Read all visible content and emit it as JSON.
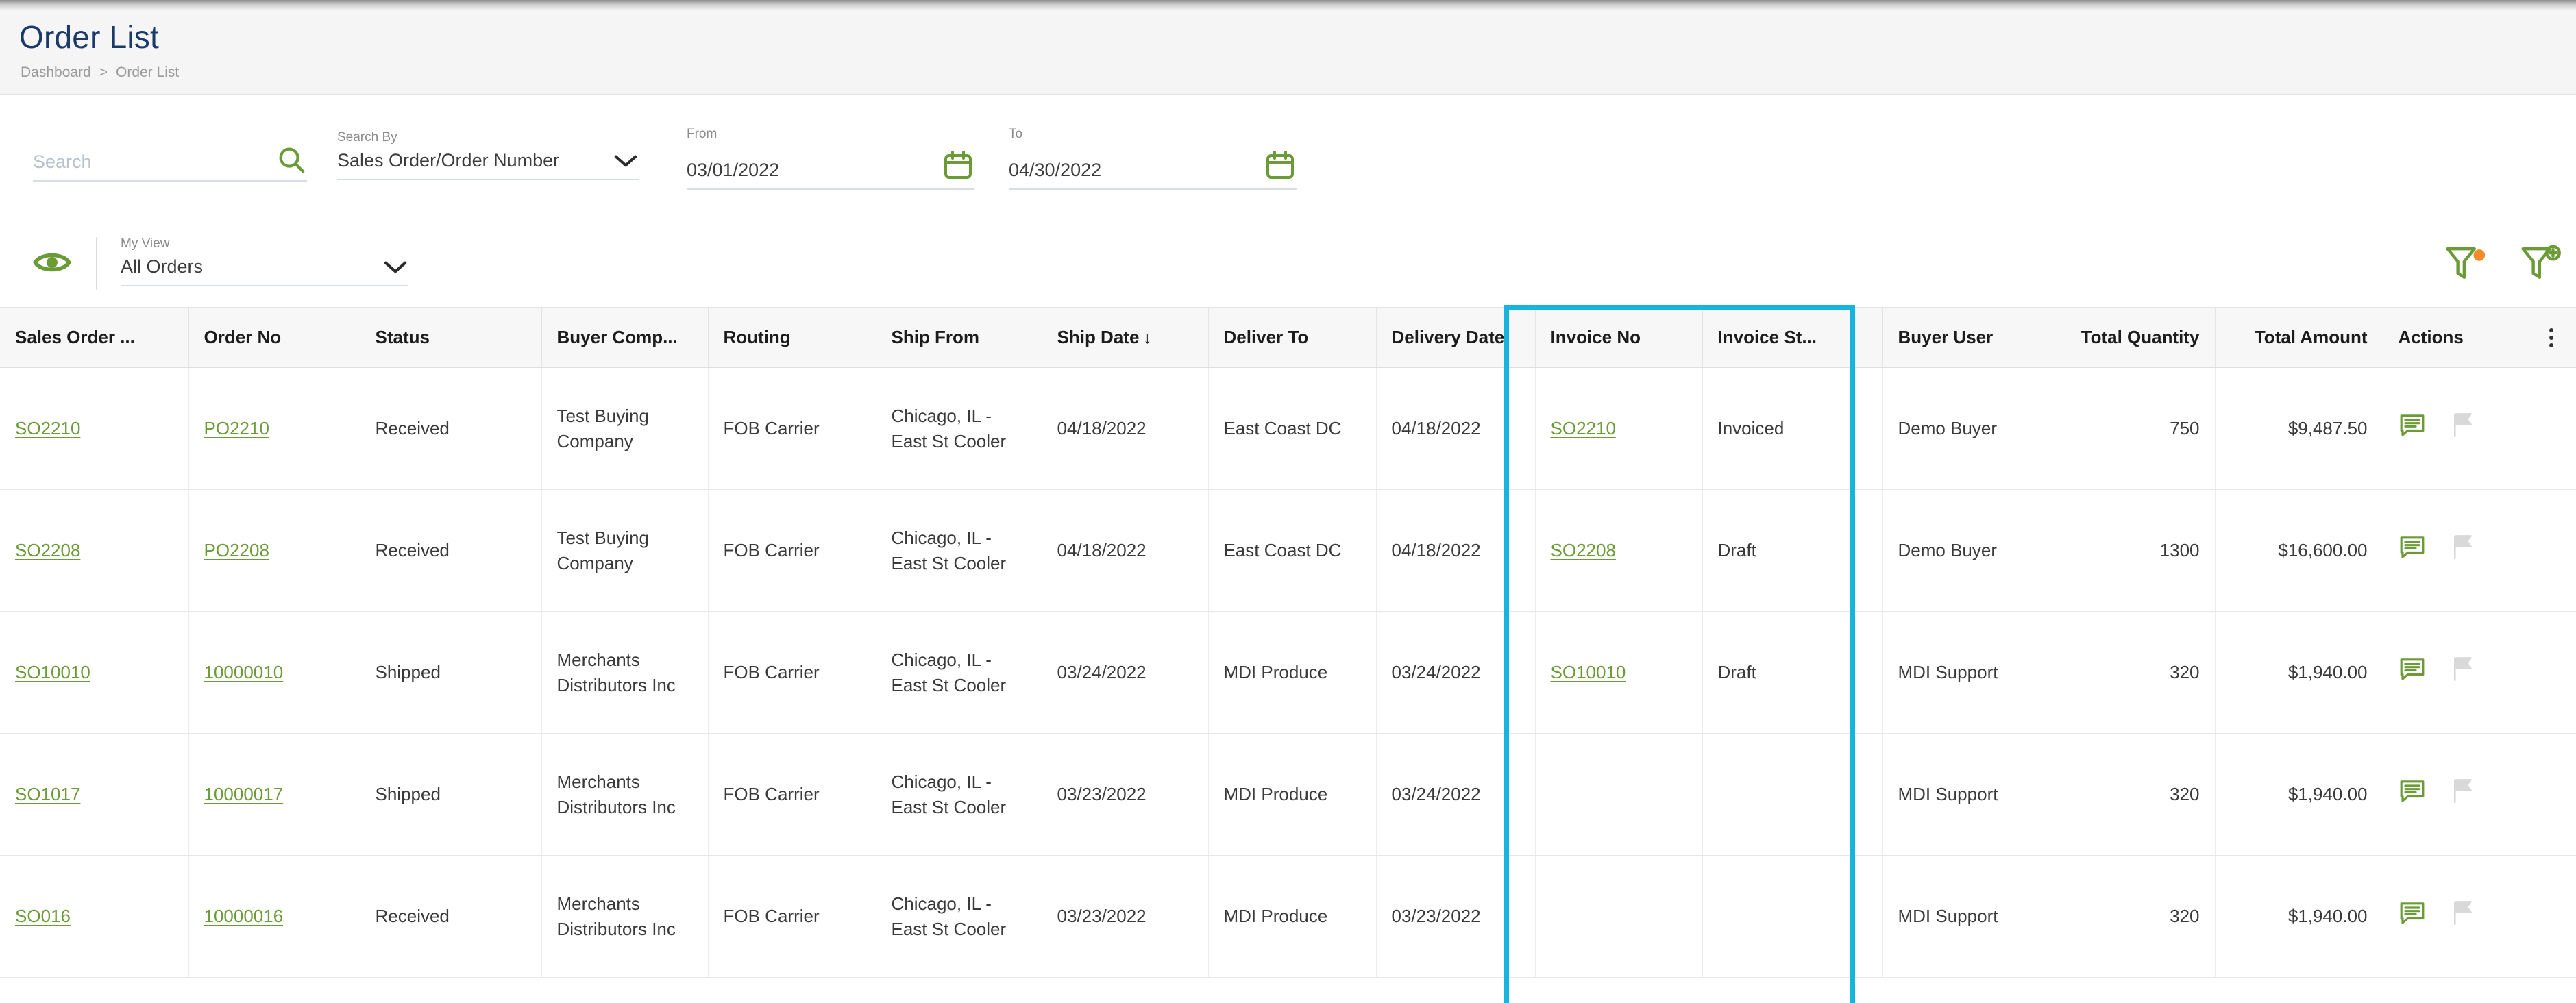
{
  "header": {
    "title": "Order List",
    "breadcrumb": {
      "root": "Dashboard",
      "separator": ">",
      "current": "Order List"
    }
  },
  "filters": {
    "search": {
      "placeholder": "Search",
      "value": "",
      "icon": "search-icon"
    },
    "search_by": {
      "label": "Search By",
      "value": "Sales Order/Order Number",
      "icon": "chevron-down-icon"
    },
    "from": {
      "label": "From",
      "value": "03/01/2022",
      "icon": "calendar-icon"
    },
    "to": {
      "label": "To",
      "value": "04/30/2022",
      "icon": "calendar-icon"
    }
  },
  "view_bar": {
    "eye_icon": "eye-icon",
    "my_view": {
      "label": "My View",
      "value": "All Orders",
      "icon": "chevron-down-icon"
    },
    "filter_icon": "filter-funnel-icon",
    "filter_badge_color": "#f28c28",
    "add_filter_icon": "filter-funnel-add-icon"
  },
  "table": {
    "columns": [
      {
        "key": "sales_order",
        "label": "Sales Order ...",
        "align": "left"
      },
      {
        "key": "order_no",
        "label": "Order No",
        "align": "left"
      },
      {
        "key": "status",
        "label": "Status",
        "align": "left"
      },
      {
        "key": "buyer_company",
        "label": "Buyer Comp...",
        "align": "left"
      },
      {
        "key": "routing",
        "label": "Routing",
        "align": "left"
      },
      {
        "key": "ship_from",
        "label": "Ship From",
        "align": "left"
      },
      {
        "key": "ship_date",
        "label": "Ship Date",
        "align": "left",
        "sort": "desc",
        "sort_glyph": "↓"
      },
      {
        "key": "deliver_to",
        "label": "Deliver To",
        "align": "left"
      },
      {
        "key": "delivery_date",
        "label": "Delivery Date",
        "align": "left"
      },
      {
        "key": "invoice_no",
        "label": "Invoice No",
        "align": "left"
      },
      {
        "key": "invoice_status",
        "label": "Invoice St...",
        "align": "left"
      },
      {
        "key": "buyer_user",
        "label": "Buyer User",
        "align": "left"
      },
      {
        "key": "total_quantity",
        "label": "Total Quantity",
        "align": "right"
      },
      {
        "key": "total_amount",
        "label": "Total Amount",
        "align": "right"
      },
      {
        "key": "actions",
        "label": "Actions",
        "align": "left"
      }
    ],
    "column_menu_icon": "kebab-menu-icon",
    "rows": [
      {
        "sales_order": "SO2210",
        "order_no": "PO2210",
        "status": "Received",
        "buyer_company": "Test Buying Company",
        "routing": "FOB Carrier",
        "ship_from": "Chicago, IL - East St Cooler",
        "ship_date": "04/18/2022",
        "deliver_to": "East Coast DC",
        "delivery_date": "04/18/2022",
        "invoice_no": "SO2210",
        "invoice_status": "Invoiced",
        "buyer_user": "Demo Buyer",
        "total_quantity": "750",
        "total_amount": "$9,487.50",
        "actions": {
          "note_icon": "note-icon",
          "flag_icon": "flag-icon"
        }
      },
      {
        "sales_order": "SO2208",
        "order_no": "PO2208",
        "status": "Received",
        "buyer_company": "Test Buying Company",
        "routing": "FOB Carrier",
        "ship_from": "Chicago, IL - East St Cooler",
        "ship_date": "04/18/2022",
        "deliver_to": "East Coast DC",
        "delivery_date": "04/18/2022",
        "invoice_no": "SO2208",
        "invoice_status": "Draft",
        "buyer_user": "Demo Buyer",
        "total_quantity": "1300",
        "total_amount": "$16,600.00",
        "actions": {
          "note_icon": "note-icon",
          "flag_icon": "flag-icon"
        }
      },
      {
        "sales_order": "SO10010",
        "order_no": "10000010",
        "status": "Shipped",
        "buyer_company": "Merchants Distributors Inc",
        "routing": "FOB Carrier",
        "ship_from": "Chicago, IL - East St Cooler",
        "ship_date": "03/24/2022",
        "deliver_to": "MDI Produce",
        "delivery_date": "03/24/2022",
        "invoice_no": "SO10010",
        "invoice_status": "Draft",
        "buyer_user": "MDI Support",
        "total_quantity": "320",
        "total_amount": "$1,940.00",
        "actions": {
          "note_icon": "note-icon",
          "flag_icon": "flag-icon"
        }
      },
      {
        "sales_order": "SO1017",
        "order_no": "10000017",
        "status": "Shipped",
        "buyer_company": "Merchants Distributors Inc",
        "routing": "FOB Carrier",
        "ship_from": "Chicago, IL - East St Cooler",
        "ship_date": "03/23/2022",
        "deliver_to": "MDI Produce",
        "delivery_date": "03/24/2022",
        "invoice_no": "",
        "invoice_status": "",
        "buyer_user": "MDI Support",
        "total_quantity": "320",
        "total_amount": "$1,940.00",
        "actions": {
          "note_icon": "note-icon",
          "flag_icon": "flag-icon"
        }
      },
      {
        "sales_order": "SO016",
        "order_no": "10000016",
        "status": "Received",
        "buyer_company": "Merchants Distributors Inc",
        "routing": "FOB Carrier",
        "ship_from": "Chicago, IL - East St Cooler",
        "ship_date": "03/23/2022",
        "deliver_to": "MDI Produce",
        "delivery_date": "03/23/2022",
        "invoice_no": "",
        "invoice_status": "",
        "buyer_user": "MDI Support",
        "total_quantity": "320",
        "total_amount": "$1,940.00",
        "actions": {
          "note_icon": "note-icon",
          "flag_icon": "flag-icon"
        }
      }
    ]
  },
  "annotation": {
    "highlight_color": "#17b4e0",
    "covers_columns": [
      "Invoice No",
      "Invoice St..."
    ]
  },
  "theme": {
    "accent_green": "#6b9b37",
    "title_navy": "#1b3a6b",
    "badge_orange": "#f28c28",
    "highlight_cyan": "#17b4e0"
  }
}
